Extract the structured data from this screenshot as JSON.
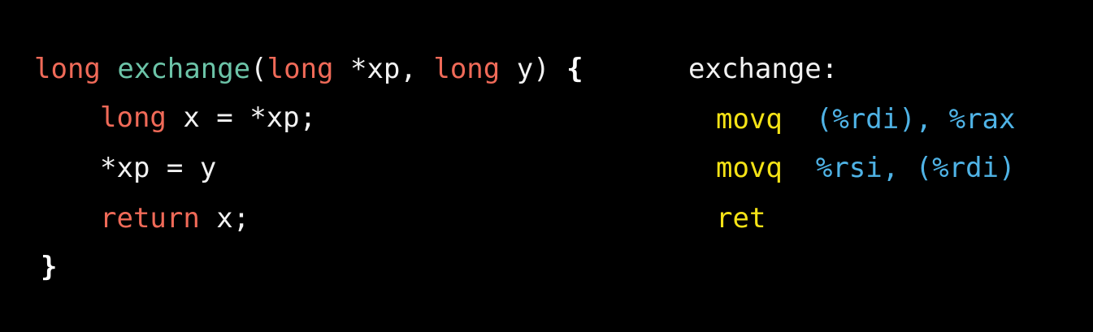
{
  "c_code": {
    "line1": {
      "ret_type": "long",
      "func_name": "exchange",
      "open_paren": "(",
      "param1_type": "long",
      "param1_name": " *xp, ",
      "param2_type": "long",
      "param2_name": " y) ",
      "open_brace": "{"
    },
    "line2": {
      "type": "long",
      "rest": " x = *xp;"
    },
    "line3": {
      "stmt": "*xp = y"
    },
    "line4": {
      "keyword": "return",
      "rest": " x;"
    },
    "line5": {
      "close_brace": "}"
    }
  },
  "assembly": {
    "label": "exchange:",
    "instructions": [
      {
        "op": "movq",
        "operands": "(%rdi), %rax"
      },
      {
        "op": "movq",
        "operands": "%rsi, (%rdi)"
      },
      {
        "op": "ret",
        "operands": ""
      }
    ]
  },
  "colors": {
    "background": "#000000",
    "c_keyword": "#f06a58",
    "c_function": "#6cc4a8",
    "asm_instruction": "#f5e316",
    "asm_register": "#4fb3e6",
    "default_text": "#f2f2f2"
  }
}
